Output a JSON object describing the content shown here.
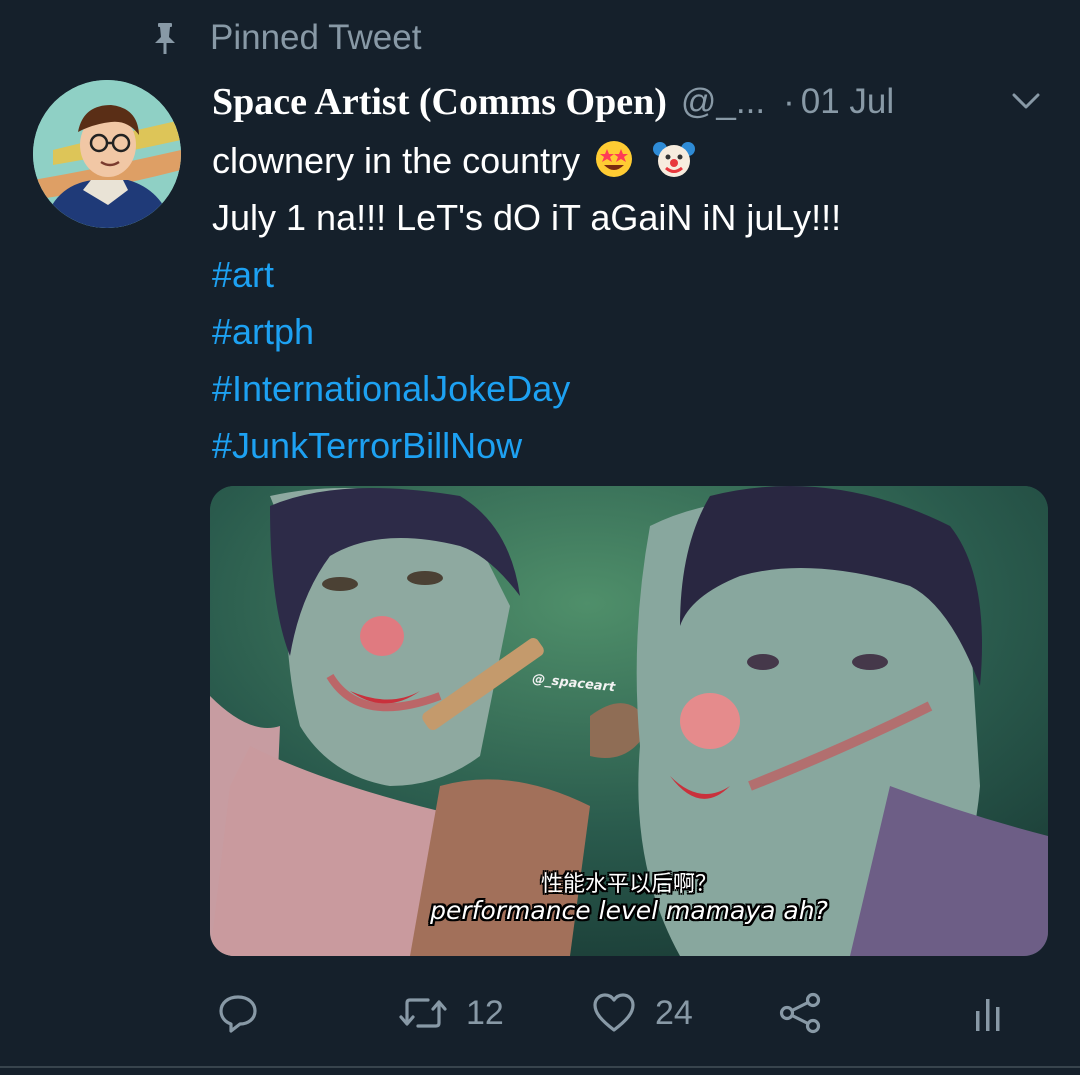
{
  "pinned": {
    "label": "Pinned Tweet",
    "icon": "pin-icon"
  },
  "tweet": {
    "display_name": "Space Artist (Comms Open)",
    "handle": "@_...",
    "separator": "·",
    "date": "01 Jul",
    "text_line_1": "clownery in the country",
    "text_line_2": "July 1 na!!! LeT's dO iT aGaiN iN juLy!!!",
    "hashtags": [
      "#art",
      "#artph",
      "#InternationalJokeDay",
      "#JunkTerrorBillNow"
    ],
    "emojis": [
      "star-struck-emoji",
      "clown-face-emoji"
    ]
  },
  "media": {
    "subtitle_chinese": "性能水平以后啊？",
    "subtitle_english": "performance level mamaya ah?",
    "watermark": "@_spaceart"
  },
  "actions": {
    "reply": {
      "icon": "reply-icon"
    },
    "retweet": {
      "icon": "retweet-icon",
      "count": "12"
    },
    "like": {
      "icon": "heart-icon",
      "count": "24"
    },
    "share": {
      "icon": "share-icon"
    },
    "analytics": {
      "icon": "analytics-icon"
    }
  },
  "colors": {
    "background": "#15202b",
    "secondary_text": "#8899a6",
    "link": "#1da1f2",
    "primary_text": "#ffffff"
  }
}
